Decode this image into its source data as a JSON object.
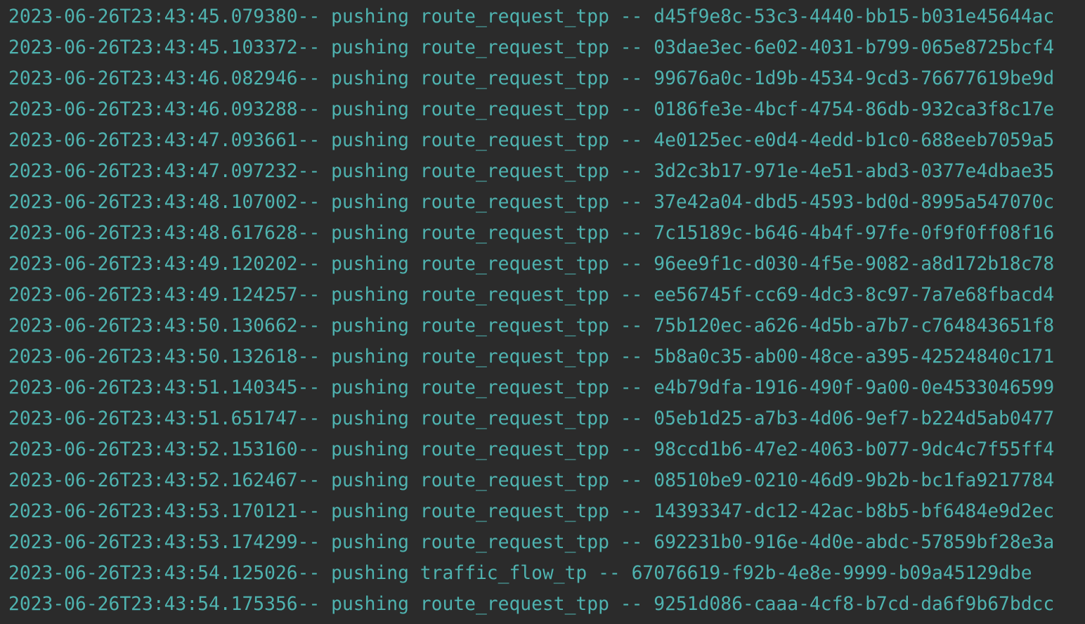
{
  "console": {
    "text_color": "#4fb3b0",
    "background_color": "#2b2b2b",
    "lines": [
      "2023-06-26T23:43:45.079380-- pushing route_request_tpp -- d45f9e8c-53c3-4440-bb15-b031e45644ac",
      "2023-06-26T23:43:45.103372-- pushing route_request_tpp -- 03dae3ec-6e02-4031-b799-065e8725bcf4",
      "2023-06-26T23:43:46.082946-- pushing route_request_tpp -- 99676a0c-1d9b-4534-9cd3-76677619be9d",
      "2023-06-26T23:43:46.093288-- pushing route_request_tpp -- 0186fe3e-4bcf-4754-86db-932ca3f8c17e",
      "2023-06-26T23:43:47.093661-- pushing route_request_tpp -- 4e0125ec-e0d4-4edd-b1c0-688eeb7059a5",
      "2023-06-26T23:43:47.097232-- pushing route_request_tpp -- 3d2c3b17-971e-4e51-abd3-0377e4dbae35",
      "2023-06-26T23:43:48.107002-- pushing route_request_tpp -- 37e42a04-dbd5-4593-bd0d-8995a547070c",
      "2023-06-26T23:43:48.617628-- pushing route_request_tpp -- 7c15189c-b646-4b4f-97fe-0f9f0ff08f16",
      "2023-06-26T23:43:49.120202-- pushing route_request_tpp -- 96ee9f1c-d030-4f5e-9082-a8d172b18c78",
      "2023-06-26T23:43:49.124257-- pushing route_request_tpp -- ee56745f-cc69-4dc3-8c97-7a7e68fbacd4",
      "2023-06-26T23:43:50.130662-- pushing route_request_tpp -- 75b120ec-a626-4d5b-a7b7-c764843651f8",
      "2023-06-26T23:43:50.132618-- pushing route_request_tpp -- 5b8a0c35-ab00-48ce-a395-42524840c171",
      "2023-06-26T23:43:51.140345-- pushing route_request_tpp -- e4b79dfa-1916-490f-9a00-0e4533046599",
      "2023-06-26T23:43:51.651747-- pushing route_request_tpp -- 05eb1d25-a7b3-4d06-9ef7-b224d5ab0477",
      "2023-06-26T23:43:52.153160-- pushing route_request_tpp -- 98ccd1b6-47e2-4063-b077-9dc4c7f55ff4",
      "2023-06-26T23:43:52.162467-- pushing route_request_tpp -- 08510be9-0210-46d9-9b2b-bc1fa9217784",
      "2023-06-26T23:43:53.170121-- pushing route_request_tpp -- 14393347-dc12-42ac-b8b5-bf6484e9d2ec",
      "2023-06-26T23:43:53.174299-- pushing route_request_tpp -- 692231b0-916e-4d0e-abdc-57859bf28e3a",
      "2023-06-26T23:43:54.125026-- pushing traffic_flow_tp -- 67076619-f92b-4e8e-9999-b09a45129dbe",
      "2023-06-26T23:43:54.175356-- pushing route_request_tpp -- 9251d086-caaa-4cf8-b7cd-da6f9b67bdcc"
    ]
  }
}
